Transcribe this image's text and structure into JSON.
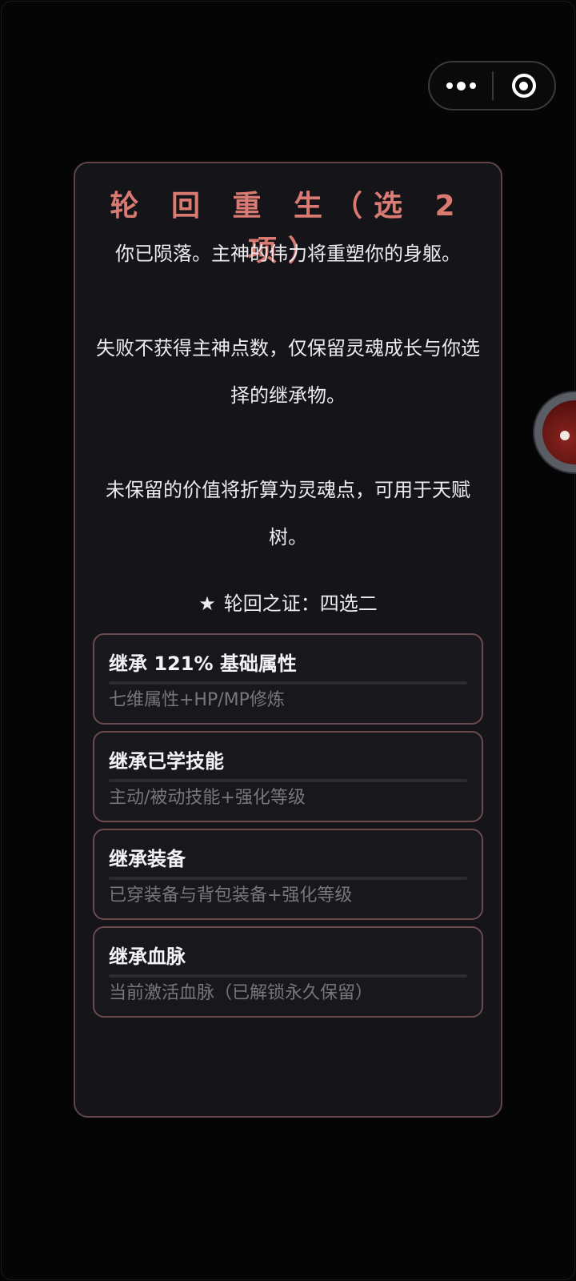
{
  "capsule": {
    "more_icon": "more-dots-icon",
    "close_icon": "target-close-icon"
  },
  "dialog": {
    "title": "轮 回 重 生（选 2 项）",
    "description": "你已陨落。主神的伟力将重塑你的身躯。\n\n失败不获得主神点数，仅保留灵魂成长与你选择的继承物。\n\n未保留的价值将折算为灵魂点，可用于天赋树。",
    "badge_star": "★",
    "badge_text": "轮回之证：四选二"
  },
  "options": [
    {
      "title": "继承 121% 基础属性",
      "subtitle": "七维属性+HP/MP修炼"
    },
    {
      "title": "继承已学技能",
      "subtitle": "主动/被动技能+强化等级"
    },
    {
      "title": "继承装备",
      "subtitle": "已穿装备与背包装备+强化等级"
    },
    {
      "title": "继承血脉",
      "subtitle": "当前激活血脉（已解锁永久保留）"
    }
  ],
  "colors": {
    "accent_title": "#d97a73",
    "dialog_border": "#5e4547",
    "option_border": "#6a4b4d",
    "background": "#050506"
  }
}
